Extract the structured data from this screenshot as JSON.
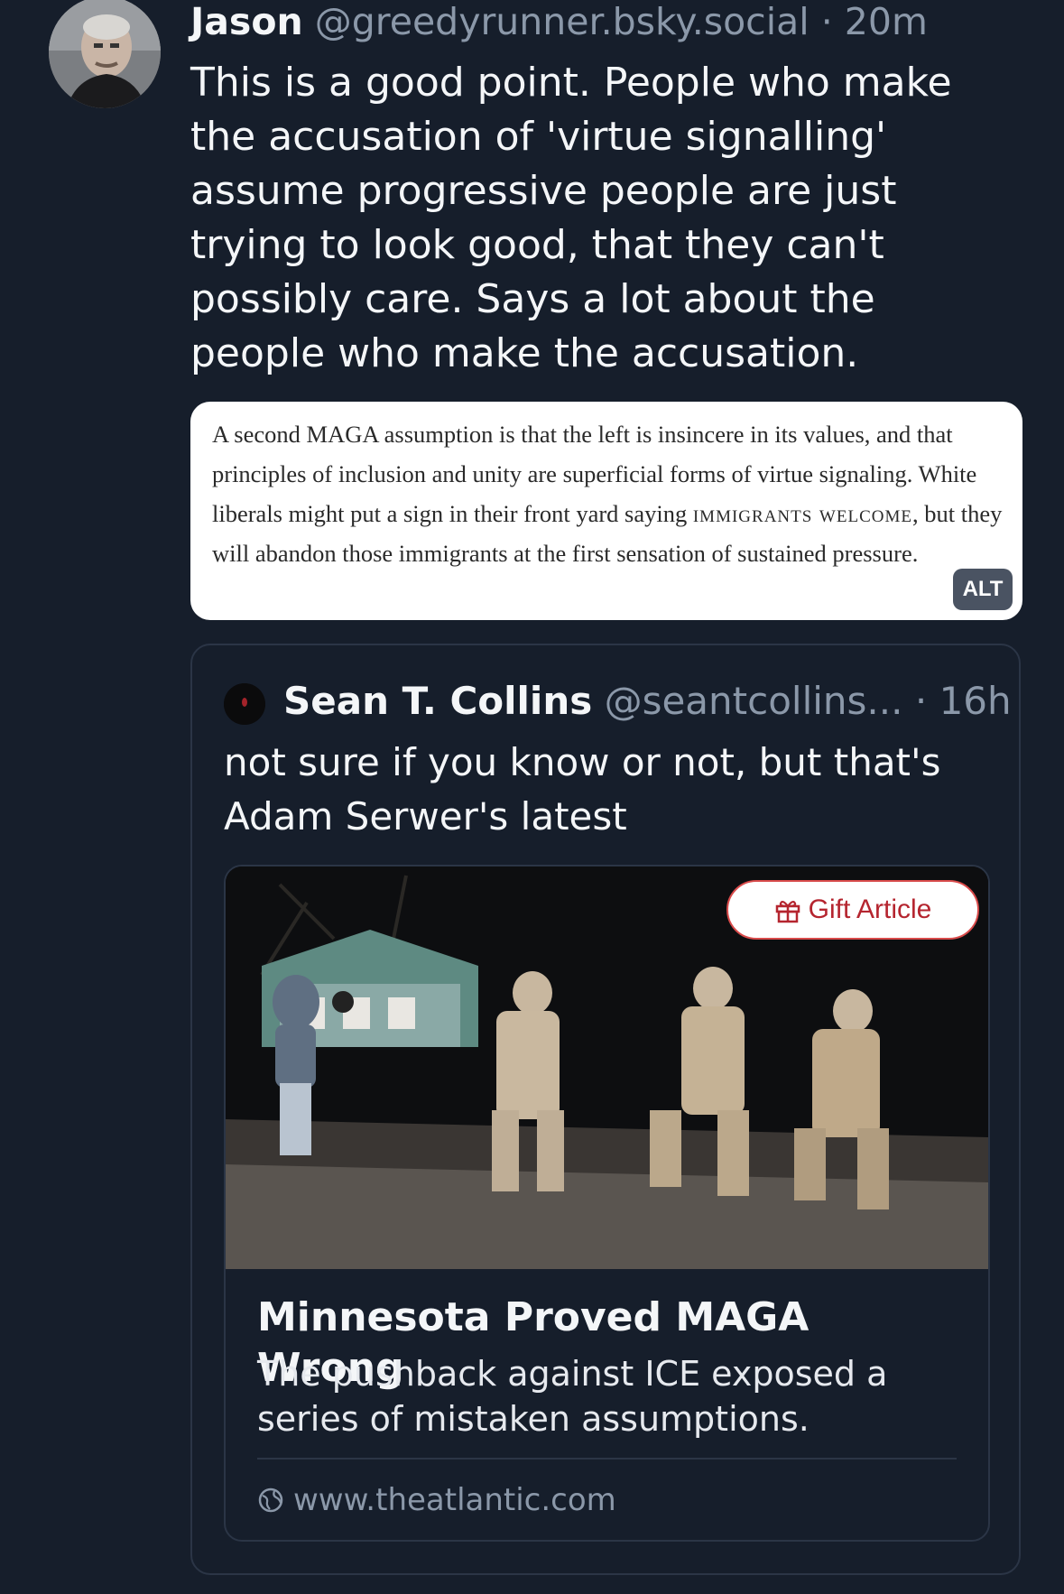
{
  "post": {
    "author_name": "Jason",
    "author_handle": "@greedyrunner.bsky.social",
    "separator": "·",
    "time": "20m",
    "text": "This is a good point. People who make the accusation of 'virtue signalling' assume progressive people are just trying to look good, that they can't possibly care. Says a lot about the people who make the accusation.",
    "image": {
      "text_part1": "A second MAGA assumption is that the left is insincere in its values, and that principles of inclusion and unity are superficial forms of virtue signaling. White liberals might put a sign in their front yard saying ",
      "text_caps1": "immigrants welcome",
      "text_part2": ", but they will abandon those immigrants at the first sensation of sustained pressure.",
      "alt_label": "ALT"
    }
  },
  "quote": {
    "author_name": "Sean T. Collins",
    "author_handle": "@seantcollins...",
    "separator": "·",
    "time": "16h",
    "text": "not sure if you know or not, but that's Adam Serwer's latest",
    "link": {
      "gift_label": "Gift Article",
      "title": "Minnesota Proved MAGA Wrong",
      "description": "The pushback against ICE exposed a series of mistaken assumptions.",
      "domain": "www.theatlantic.com"
    }
  },
  "icons": {
    "gift": "gift-icon",
    "globe": "globe-icon"
  },
  "colors": {
    "background": "#161e2b",
    "muted_text": "#8b98a9",
    "gift_accent": "#b5252f"
  }
}
